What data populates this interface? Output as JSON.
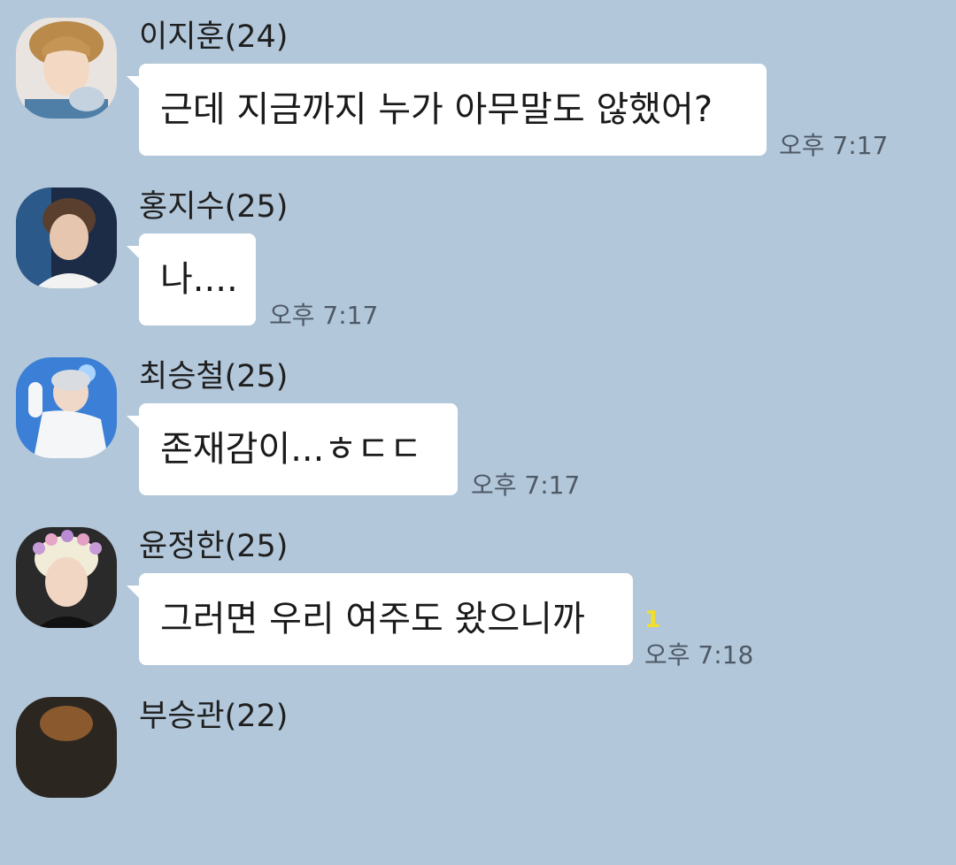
{
  "messages": [
    {
      "sender": "이지훈(24)",
      "text": "근데 지금까지 누가 아무말도 않했어?",
      "time": "오후 7:17",
      "unread": ""
    },
    {
      "sender": "홍지수(25)",
      "text": "나....",
      "time": "오후 7:17",
      "unread": ""
    },
    {
      "sender": "최승철(25)",
      "text": "존재감이...ㅎㄷㄷ",
      "time": "오후 7:17",
      "unread": ""
    },
    {
      "sender": "윤정한(25)",
      "text": "그러면 우리 여주도 왔으니까",
      "time": "오후 7:18",
      "unread": "1"
    },
    {
      "sender": "부승관(22)",
      "text": "",
      "time": "",
      "unread": ""
    }
  ],
  "colors": {
    "background": "#b2c7da",
    "bubble": "#ffffff",
    "unread_badge": "#f2de2c",
    "time_text": "#4e5966"
  },
  "icons": [
    "profile-photo-avatar"
  ]
}
